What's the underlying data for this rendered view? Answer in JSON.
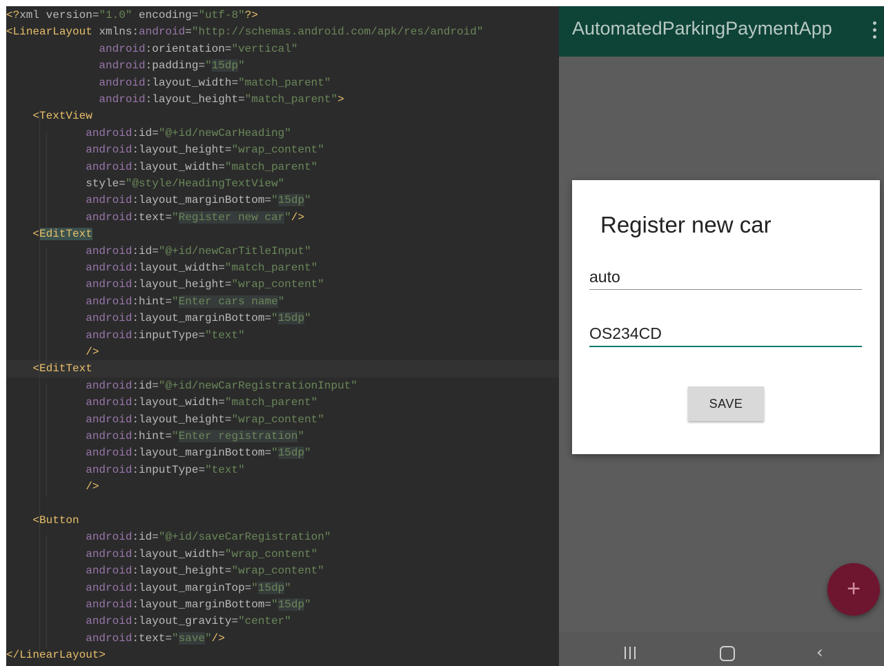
{
  "editor": {
    "lines": [
      {
        "indent": 0,
        "tokens": [
          {
            "t": "<?",
            "c": "t"
          },
          {
            "t": "xml ",
            "c": "an"
          },
          {
            "t": "version",
            "c": "an"
          },
          {
            "t": "=",
            "c": "an"
          },
          {
            "t": "\"1.0\"",
            "c": "av"
          },
          {
            "t": " encoding",
            "c": "an"
          },
          {
            "t": "=",
            "c": "an"
          },
          {
            "t": "\"utf-8\"",
            "c": "av"
          },
          {
            "t": "?>",
            "c": "t"
          }
        ]
      },
      {
        "indent": 0,
        "tokens": [
          {
            "t": "<",
            "c": "t"
          },
          {
            "t": "LinearLayout",
            "c": "tn"
          },
          {
            "t": " xmlns:",
            "c": "an"
          },
          {
            "t": "android",
            "c": "ns"
          },
          {
            "t": "=",
            "c": "an"
          },
          {
            "t": "\"http://schemas.android.com/apk/res/android\"",
            "c": "av"
          }
        ]
      },
      {
        "indent": 0,
        "tokens": [
          {
            "t": "              android",
            "c": "ns"
          },
          {
            "t": ":orientation=",
            "c": "an"
          },
          {
            "t": "\"vertical\"",
            "c": "av"
          }
        ]
      },
      {
        "indent": 0,
        "tokens": [
          {
            "t": "              android",
            "c": "ns"
          },
          {
            "t": ":padding=",
            "c": "an"
          },
          {
            "t": "\"",
            "c": "av"
          },
          {
            "t": "15dp",
            "c": "av bg"
          },
          {
            "t": "\"",
            "c": "av"
          }
        ]
      },
      {
        "indent": 0,
        "tokens": [
          {
            "t": "              android",
            "c": "ns"
          },
          {
            "t": ":layout_width=",
            "c": "an"
          },
          {
            "t": "\"match_parent\"",
            "c": "av"
          }
        ]
      },
      {
        "indent": 0,
        "tokens": [
          {
            "t": "              android",
            "c": "ns"
          },
          {
            "t": ":layout_height=",
            "c": "an"
          },
          {
            "t": "\"match_parent\"",
            "c": "av"
          },
          {
            "t": ">",
            "c": "t"
          }
        ]
      },
      {
        "indent": 0,
        "tokens": [
          {
            "t": "    <",
            "c": "t"
          },
          {
            "t": "TextView",
            "c": "tn"
          }
        ]
      },
      {
        "indent": 0,
        "tokens": [
          {
            "t": "            android",
            "c": "ns"
          },
          {
            "t": ":id=",
            "c": "an"
          },
          {
            "t": "\"@+id/newCarHeading\"",
            "c": "av"
          }
        ]
      },
      {
        "indent": 0,
        "tokens": [
          {
            "t": "            android",
            "c": "ns"
          },
          {
            "t": ":layout_height=",
            "c": "an"
          },
          {
            "t": "\"wrap_content\"",
            "c": "av"
          }
        ]
      },
      {
        "indent": 0,
        "tokens": [
          {
            "t": "            android",
            "c": "ns"
          },
          {
            "t": ":layout_width=",
            "c": "an"
          },
          {
            "t": "\"match_parent\"",
            "c": "av"
          }
        ]
      },
      {
        "indent": 0,
        "tokens": [
          {
            "t": "            style=",
            "c": "an"
          },
          {
            "t": "\"@style/HeadingTextView\"",
            "c": "av"
          }
        ]
      },
      {
        "indent": 0,
        "tokens": [
          {
            "t": "            android",
            "c": "ns"
          },
          {
            "t": ":layout_marginBottom=",
            "c": "an"
          },
          {
            "t": "\"",
            "c": "av"
          },
          {
            "t": "15dp",
            "c": "av bg"
          },
          {
            "t": "\"",
            "c": "av"
          }
        ]
      },
      {
        "indent": 0,
        "tokens": [
          {
            "t": "            android",
            "c": "ns"
          },
          {
            "t": ":text=",
            "c": "an"
          },
          {
            "t": "\"",
            "c": "av"
          },
          {
            "t": "Register new car",
            "c": "av bg"
          },
          {
            "t": "\"",
            "c": "av"
          },
          {
            "t": "/>",
            "c": "t"
          }
        ]
      },
      {
        "indent": 0,
        "tokens": [
          {
            "t": "    <",
            "c": "t"
          },
          {
            "t": "EditText",
            "c": "tn hl"
          }
        ]
      },
      {
        "indent": 0,
        "tokens": [
          {
            "t": "            android",
            "c": "ns"
          },
          {
            "t": ":id=",
            "c": "an"
          },
          {
            "t": "\"@+id/newCarTitleInput\"",
            "c": "av"
          }
        ]
      },
      {
        "indent": 0,
        "tokens": [
          {
            "t": "            android",
            "c": "ns"
          },
          {
            "t": ":layout_width=",
            "c": "an"
          },
          {
            "t": "\"match_parent\"",
            "c": "av"
          }
        ]
      },
      {
        "indent": 0,
        "tokens": [
          {
            "t": "            android",
            "c": "ns"
          },
          {
            "t": ":layout_height=",
            "c": "an"
          },
          {
            "t": "\"wrap_content\"",
            "c": "av"
          }
        ]
      },
      {
        "indent": 0,
        "tokens": [
          {
            "t": "            android",
            "c": "ns"
          },
          {
            "t": ":hint=",
            "c": "an"
          },
          {
            "t": "\"",
            "c": "av"
          },
          {
            "t": "Enter cars name",
            "c": "av bg"
          },
          {
            "t": "\"",
            "c": "av"
          }
        ]
      },
      {
        "indent": 0,
        "tokens": [
          {
            "t": "            android",
            "c": "ns"
          },
          {
            "t": ":layout_marginBottom=",
            "c": "an"
          },
          {
            "t": "\"",
            "c": "av"
          },
          {
            "t": "15dp",
            "c": "av bg"
          },
          {
            "t": "\"",
            "c": "av"
          }
        ]
      },
      {
        "indent": 0,
        "tokens": [
          {
            "t": "            android",
            "c": "ns"
          },
          {
            "t": ":inputType=",
            "c": "an"
          },
          {
            "t": "\"text\"",
            "c": "av"
          }
        ]
      },
      {
        "indent": 0,
        "tokens": [
          {
            "t": "            />",
            "c": "t"
          }
        ]
      },
      {
        "indent": 0,
        "current": true,
        "tokens": [
          {
            "t": "    <",
            "c": "t"
          },
          {
            "t": "EditText",
            "c": "tn"
          }
        ]
      },
      {
        "indent": 0,
        "tokens": [
          {
            "t": "            android",
            "c": "ns"
          },
          {
            "t": ":id=",
            "c": "an"
          },
          {
            "t": "\"@+id/newCarRegistrationInput\"",
            "c": "av"
          }
        ]
      },
      {
        "indent": 0,
        "tokens": [
          {
            "t": "            android",
            "c": "ns"
          },
          {
            "t": ":layout_width=",
            "c": "an"
          },
          {
            "t": "\"match_parent\"",
            "c": "av"
          }
        ]
      },
      {
        "indent": 0,
        "tokens": [
          {
            "t": "            android",
            "c": "ns"
          },
          {
            "t": ":layout_height=",
            "c": "an"
          },
          {
            "t": "\"wrap_content\"",
            "c": "av"
          }
        ]
      },
      {
        "indent": 0,
        "tokens": [
          {
            "t": "            android",
            "c": "ns"
          },
          {
            "t": ":hint=",
            "c": "an"
          },
          {
            "t": "\"",
            "c": "av"
          },
          {
            "t": "Enter registration",
            "c": "av bg"
          },
          {
            "t": "\"",
            "c": "av"
          }
        ]
      },
      {
        "indent": 0,
        "tokens": [
          {
            "t": "            android",
            "c": "ns"
          },
          {
            "t": ":layout_marginBottom=",
            "c": "an"
          },
          {
            "t": "\"",
            "c": "av"
          },
          {
            "t": "15dp",
            "c": "av bg"
          },
          {
            "t": "\"",
            "c": "av"
          }
        ]
      },
      {
        "indent": 0,
        "tokens": [
          {
            "t": "            android",
            "c": "ns"
          },
          {
            "t": ":inputType=",
            "c": "an"
          },
          {
            "t": "\"text\"",
            "c": "av"
          }
        ]
      },
      {
        "indent": 0,
        "tokens": [
          {
            "t": "            />",
            "c": "t"
          }
        ]
      },
      {
        "indent": 0,
        "tokens": []
      },
      {
        "indent": 0,
        "tokens": [
          {
            "t": "    <",
            "c": "t"
          },
          {
            "t": "Button",
            "c": "tn"
          }
        ]
      },
      {
        "indent": 0,
        "tokens": [
          {
            "t": "            android",
            "c": "ns"
          },
          {
            "t": ":id=",
            "c": "an"
          },
          {
            "t": "\"@+id/saveCarRegistration\"",
            "c": "av"
          }
        ]
      },
      {
        "indent": 0,
        "tokens": [
          {
            "t": "            android",
            "c": "ns"
          },
          {
            "t": ":layout_width=",
            "c": "an"
          },
          {
            "t": "\"wrap_content\"",
            "c": "av"
          }
        ]
      },
      {
        "indent": 0,
        "tokens": [
          {
            "t": "            android",
            "c": "ns"
          },
          {
            "t": ":layout_height=",
            "c": "an"
          },
          {
            "t": "\"wrap_content\"",
            "c": "av"
          }
        ]
      },
      {
        "indent": 0,
        "tokens": [
          {
            "t": "            android",
            "c": "ns"
          },
          {
            "t": ":layout_marginTop=",
            "c": "an"
          },
          {
            "t": "\"",
            "c": "av"
          },
          {
            "t": "15dp",
            "c": "av bg"
          },
          {
            "t": "\"",
            "c": "av"
          }
        ]
      },
      {
        "indent": 0,
        "tokens": [
          {
            "t": "            android",
            "c": "ns"
          },
          {
            "t": ":layout_marginBottom=",
            "c": "an"
          },
          {
            "t": "\"",
            "c": "av"
          },
          {
            "t": "15dp",
            "c": "av bg"
          },
          {
            "t": "\"",
            "c": "av"
          }
        ]
      },
      {
        "indent": 0,
        "tokens": [
          {
            "t": "            android",
            "c": "ns"
          },
          {
            "t": ":layout_gravity=",
            "c": "an"
          },
          {
            "t": "\"center\"",
            "c": "av"
          }
        ]
      },
      {
        "indent": 0,
        "tokens": [
          {
            "t": "            android",
            "c": "ns"
          },
          {
            "t": ":text=",
            "c": "an"
          },
          {
            "t": "\"",
            "c": "av"
          },
          {
            "t": "save",
            "c": "av bg"
          },
          {
            "t": "\"",
            "c": "av"
          },
          {
            "t": "/>",
            "c": "t"
          }
        ]
      },
      {
        "indent": 0,
        "tokens": [
          {
            "t": "</",
            "c": "t"
          },
          {
            "t": "LinearLayout",
            "c": "tn"
          },
          {
            "t": ">",
            "c": "t"
          }
        ]
      }
    ]
  },
  "phone": {
    "app_title": "AutomatedParkingPaymentApp",
    "dialog": {
      "heading": "Register new car",
      "car_name_value": "auto",
      "car_name_hint": "Enter cars name",
      "registration_value": "OS234CD",
      "registration_hint": "Enter registration",
      "save_label": "SAVE"
    },
    "fab_label": "+",
    "nav_back_label": "‹"
  }
}
